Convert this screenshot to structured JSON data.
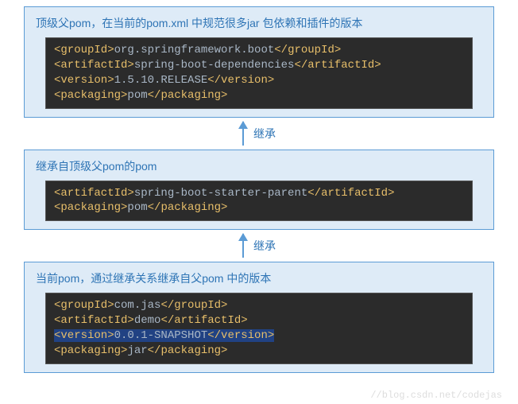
{
  "boxes": [
    {
      "title": "顶级父pom，在当前的pom.xml 中规范很多jar 包依赖和插件的版本",
      "lines": [
        {
          "t": "groupId",
          "v": "org.springframework.boot"
        },
        {
          "t": "artifactId",
          "v": "spring-boot-dependencies"
        },
        {
          "t": "version",
          "v": "1.5.10.RELEASE"
        },
        {
          "t": "packaging",
          "v": "pom"
        }
      ]
    },
    {
      "title": "继承自顶级父pom的pom",
      "lines": [
        {
          "t": "artifactId",
          "v": "spring-boot-starter-parent"
        },
        {
          "t": "packaging",
          "v": "pom"
        }
      ]
    },
    {
      "title": "当前pom，通过继承关系继承自父pom 中的版本",
      "lines": [
        {
          "t": "groupId",
          "v": "com.jas"
        },
        {
          "t": "artifactId",
          "v": "demo"
        },
        {
          "t": "version",
          "v": "0.0.1-SNAPSHOT",
          "hl": true
        },
        {
          "t": "packaging",
          "v": "jar"
        }
      ]
    }
  ],
  "arrow_label": "继承",
  "watermark": "//blog.csdn.net/codejas"
}
